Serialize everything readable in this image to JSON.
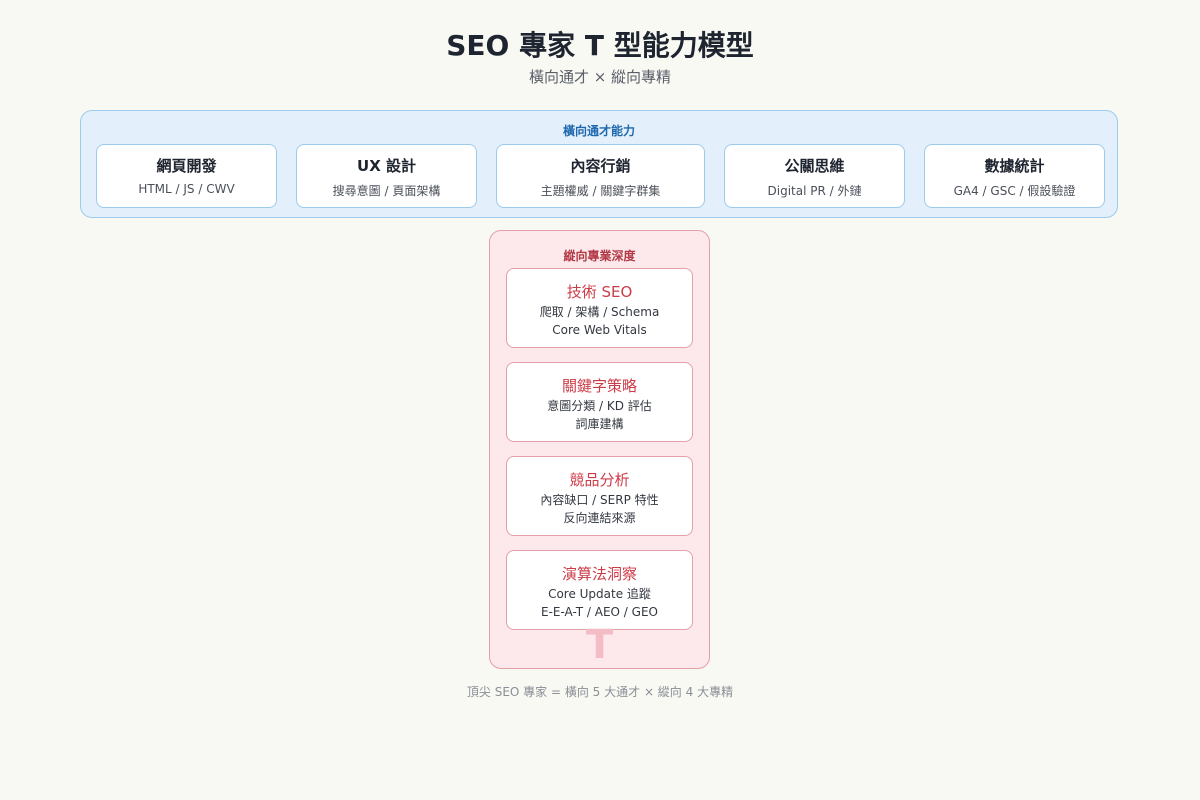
{
  "title": "SEO 專家 T 型能力模型",
  "subtitle": "橫向通才 × 縱向專精",
  "horizontal": {
    "label": "橫向通才能力",
    "cards": [
      {
        "name": "網頁開發",
        "desc": "HTML / JS / CWV"
      },
      {
        "name": "UX 設計",
        "desc": "搜尋意圖 / 頁面架構"
      },
      {
        "name": "內容行銷",
        "desc": "主題權威 / 關鍵字群集"
      },
      {
        "name": "公關思維",
        "desc": "Digital PR / 外鏈"
      },
      {
        "name": "數據統計",
        "desc": "GA4 / GSC / 假設驗證"
      }
    ]
  },
  "vertical": {
    "label": "縱向專業深度",
    "cards": [
      {
        "name": "技術 SEO",
        "line1": "爬取 / 架構 / Schema",
        "line2": "Core Web Vitals"
      },
      {
        "name": "關鍵字策略",
        "line1": "意圖分類 / KD 評估",
        "line2": "詞庫建構"
      },
      {
        "name": "競品分析",
        "line1": "內容缺口 / SERP 特性",
        "line2": "反向連結來源"
      },
      {
        "name": "演算法洞察",
        "line1": "Core Update 追蹤",
        "line2": "E-E-A-T / AEO / GEO"
      }
    ],
    "glyph": "T"
  },
  "footer": "頂尖 SEO 專家 = 橫向 5 大通才 × 縱向 4 大專精",
  "colors": {
    "background": "#f9f9f4",
    "horizontal_fill": "#e3f0fb",
    "horizontal_border": "#9ccbec",
    "horizontal_title": "#1e68ad",
    "vertical_fill": "#fde8eb",
    "vertical_border": "#e3a0a8",
    "vertical_title": "#cc3c48"
  }
}
